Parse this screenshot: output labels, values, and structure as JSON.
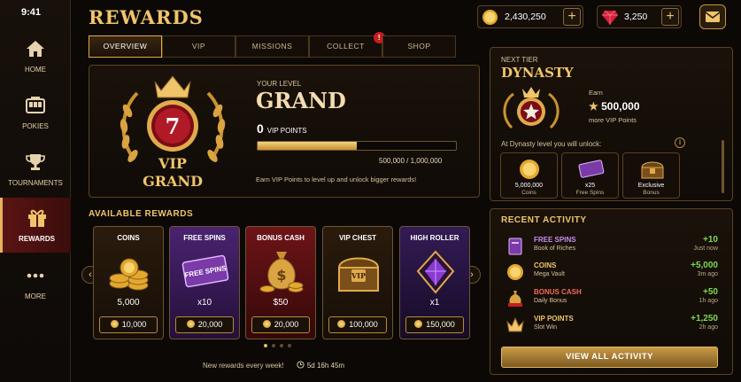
{
  "status": {
    "time": "9:41"
  },
  "header": {
    "title": "REWARDS",
    "coins": "2,430,250",
    "gems": "3,250"
  },
  "sidebar": {
    "items": [
      {
        "label": "HOME",
        "icon": "home-icon"
      },
      {
        "label": "POKIES",
        "icon": "slot-machine-icon"
      },
      {
        "label": "TOURNAMENTS",
        "icon": "trophy-icon"
      },
      {
        "label": "REWARDS",
        "icon": "gift-icon",
        "active": true
      },
      {
        "label": "MORE",
        "icon": "more-icon"
      }
    ]
  },
  "tabs": [
    {
      "label": "OVERVIEW",
      "active": true
    },
    {
      "label": "VIP"
    },
    {
      "label": "MISSIONS"
    },
    {
      "label": "COLLECT",
      "badge": "!"
    },
    {
      "label": "SHOP"
    }
  ],
  "vip": {
    "badge_number": "7",
    "badge_top": "VIP",
    "badge_bottom": "GRAND",
    "level_label": "YOUR LEVEL",
    "level_name": "GRAND",
    "points": "0",
    "points_label": "VIP POINTS",
    "progress_fraction": 0.5,
    "progress_text": "500,000 / 1,000,000",
    "hint": "Earn VIP Points to level up and unlock bigger rewards!"
  },
  "rewards": {
    "title": "AVAILABLE REWARDS",
    "cards": [
      {
        "name": "COINS",
        "value": "5,000",
        "cost": "10,000"
      },
      {
        "name": "FREE SPINS",
        "value": "x10",
        "cost": "20,000"
      },
      {
        "name": "BONUS CASH",
        "value": "$50",
        "cost": "20,000"
      },
      {
        "name": "VIP CHEST",
        "value": "",
        "cost": "100,000"
      },
      {
        "name": "HIGH ROLLER",
        "value": "x1",
        "cost": "150,000"
      }
    ],
    "ticket_text": "FREE SPINS",
    "chest_text": "VIP",
    "footer": "New rewards every week!",
    "timer": "5d 16h 45m"
  },
  "next_tier": {
    "label": "NEXT TIER",
    "name": "DYNASTY",
    "earn_label": "Earn",
    "earn_value": "500,000",
    "earn_sub": "more VIP Points",
    "unlock_text": "At Dynasty level you will unlock:",
    "info": "i",
    "unlocks": [
      {
        "value": "5,000,000",
        "sub": "Coins"
      },
      {
        "value": "x25",
        "sub": "Free Spins"
      },
      {
        "value": "Exclusive",
        "sub": "Bonus"
      }
    ]
  },
  "activity": {
    "title": "RECENT ACTIVITY",
    "items": [
      {
        "title": "FREE SPINS",
        "sub": "Book of Riches",
        "value": "+10",
        "when": "Just now",
        "color": "#c98cf0"
      },
      {
        "title": "COINS",
        "sub": "Mega Vault",
        "value": "+5,000",
        "when": "3m ago",
        "color": "#f0c46a"
      },
      {
        "title": "BONUS CASH",
        "sub": "Daily Bonus",
        "value": "+50",
        "when": "1h ago",
        "color": "#f06a5a"
      },
      {
        "title": "VIP POINTS",
        "sub": "Slot Win",
        "value": "+1,250",
        "when": "2h ago",
        "color": "#f0c46a"
      }
    ],
    "button": "VIEW ALL ACTIVITY"
  }
}
